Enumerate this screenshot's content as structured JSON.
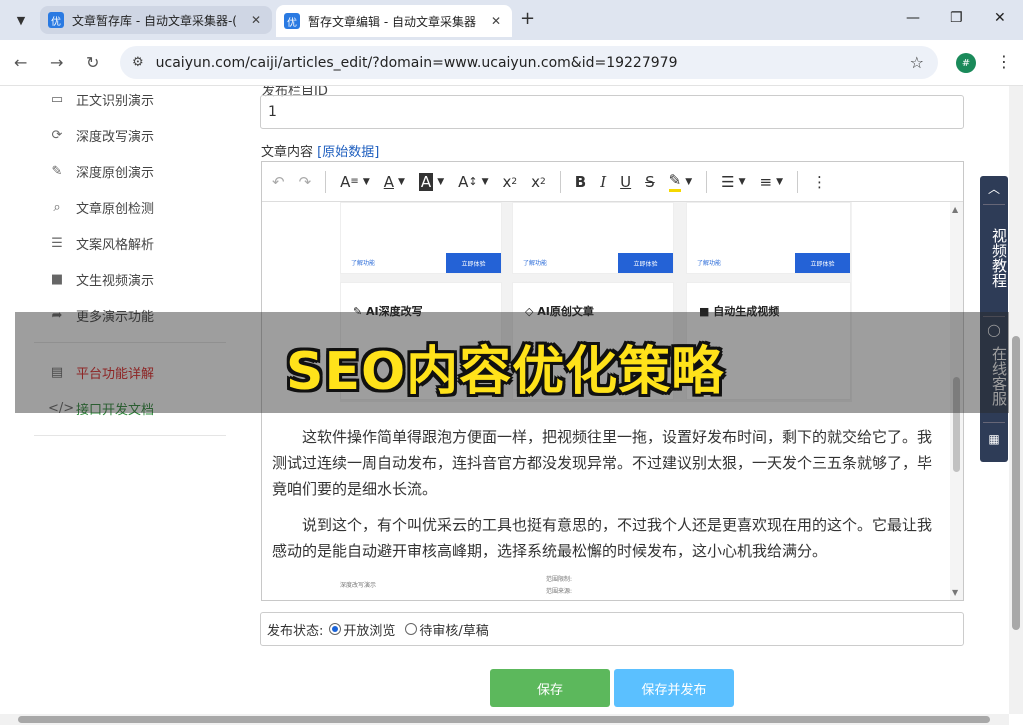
{
  "browser": {
    "tabs": [
      {
        "title": "文章暂存库 - 自动文章采集器-(",
        "favicon": "优",
        "active": false
      },
      {
        "title": "暂存文章编辑 - 自动文章采集器",
        "favicon": "优",
        "active": true
      }
    ],
    "url": "ucaiyun.com/caiji/articles_edit/?domain=www.ucaiyun.com&id=19227979",
    "profile_initial": "#"
  },
  "sidebar": {
    "items": [
      {
        "label": "正文识别演示",
        "icon": "monitor-icon"
      },
      {
        "label": "深度改写演示",
        "icon": "refresh-icon"
      },
      {
        "label": "深度原创演示",
        "icon": "edit-icon"
      },
      {
        "label": "文章原创检测",
        "icon": "search-icon"
      },
      {
        "label": "文案风格解析",
        "icon": "list-icon"
      },
      {
        "label": "文生视频演示",
        "icon": "video-icon"
      },
      {
        "label": "更多演示功能",
        "icon": "share-icon"
      }
    ],
    "links": [
      {
        "label": "平台功能详解",
        "icon": "document-icon",
        "color": "#e02424"
      },
      {
        "label": "接口开发文档",
        "icon": "code-icon",
        "color": "#2e8b3a"
      }
    ]
  },
  "form": {
    "top_label_partial": "发布栏目ID",
    "column_id_value": "1",
    "content_label": "文章内容",
    "raw_data_link": "[原始数据]",
    "status_label": "发布状态:",
    "status_options": [
      {
        "label": "开放浏览",
        "checked": true
      },
      {
        "label": "待审核/草稿",
        "checked": false
      }
    ],
    "save_button": "保存",
    "save_publish_button": "保存并发布"
  },
  "editor": {
    "embedded_cards": [
      {
        "title": "",
        "learn": "了解功能",
        "try": "立即体验"
      },
      {
        "title": "",
        "learn": "了解功能",
        "try": "立即体验"
      },
      {
        "title": "",
        "learn": "了解功能",
        "try": "立即体验"
      },
      {
        "title": "AI深度改写",
        "icon": "pen-icon"
      },
      {
        "title": "AI原创文章",
        "icon": "diamond-icon"
      },
      {
        "title": "自动生成视频",
        "icon": "video-icon"
      }
    ],
    "paragraphs": [
      "这软件操作简单得跟泡方便面一样，把视频往里一拖，设置好发布时间，剩下的就交给它了。我测试过连续一周自动发布，连抖音官方都没发现异常。不过建议别太狠，一天发个三五条就够了，毕竟咱们要的是细水长流。",
      "说到这个，有个叫优采云的工具也挺有意思的，不过我个人还是更喜欢现在用的这个。它最让我感动的是能自动避开审核高峰期，选择系统最松懈的时候发布，这小心机我给满分。"
    ],
    "mini_labels": [
      "深度改写演示",
      "范围限制:",
      "范围来源:"
    ]
  },
  "float_panel": {
    "video_tutorial": "视频教程",
    "online_service": "在线客服"
  },
  "overlay": {
    "text": "SEO内容优化策略"
  }
}
